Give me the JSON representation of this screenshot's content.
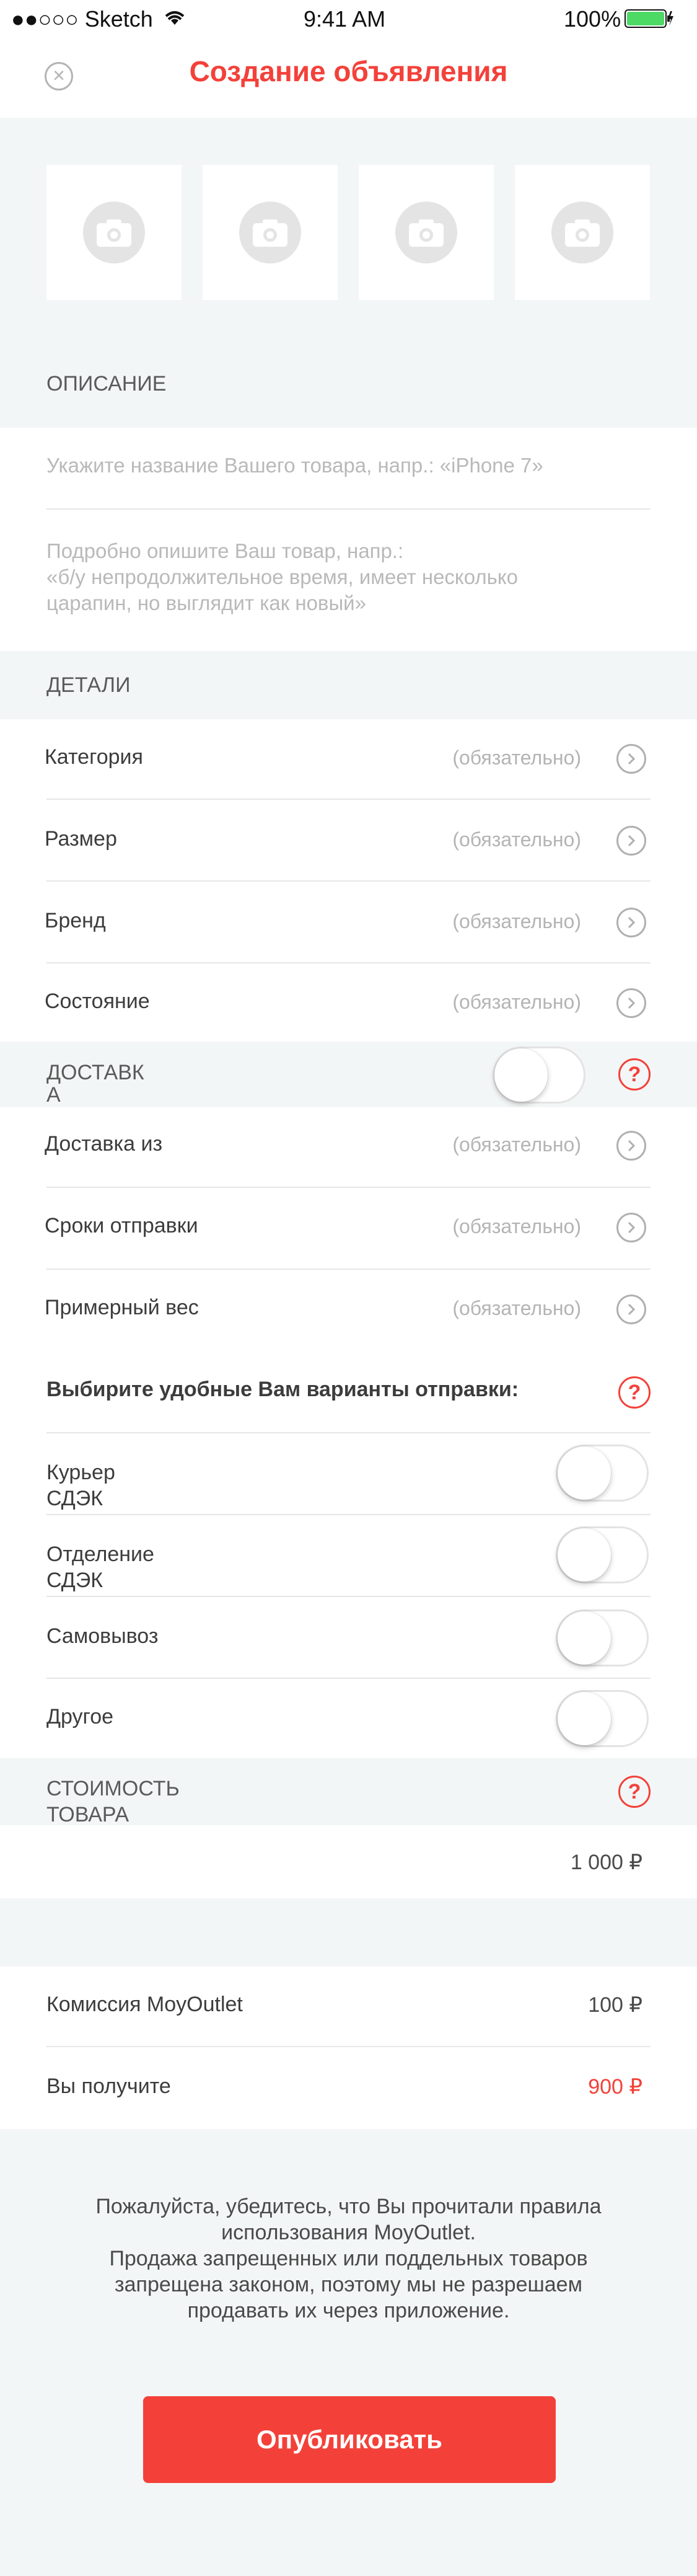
{
  "status_bar": {
    "carrier": "●●○○○ Sketch",
    "time": "9:41 AM",
    "battery": "100%"
  },
  "nav": {
    "title": "Создание объявления",
    "close_icon": "close-circle-icon"
  },
  "photos": {
    "count": 4,
    "icon": "camera-icon"
  },
  "description": {
    "header": "ОПИСАНИЕ",
    "title_placeholder": "Укажите название Вашего товара, напр.: «iPhone 7»",
    "body_placeholder_line1": "Подробно опишите Ваш товар, напр.:",
    "body_placeholder_line2": "«б/у непродолжительное время, имеет несколько",
    "body_placeholder_line3": "царапин, но выглядит как новый»"
  },
  "details": {
    "header": "ДЕТАЛИ",
    "rows": [
      {
        "label": "Категория",
        "value": "(обязательно)"
      },
      {
        "label": "Размер",
        "value": "(обязательно)"
      },
      {
        "label": "Бренд",
        "value": "(обязательно)"
      },
      {
        "label": "Состояние",
        "value": "(обязательно)"
      }
    ]
  },
  "delivery": {
    "header_line1": "ДОСТАВК",
    "header_line2": "А",
    "help": "?",
    "rows": [
      {
        "label": "Доставка из",
        "value": "(обязательно)"
      },
      {
        "label": "Сроки отправки",
        "value": "(обязательно)"
      },
      {
        "label": "Примерный вес",
        "value": "(обязательно)"
      }
    ],
    "options_title": "Выбирите удобные Вам варианты отправки:",
    "options_help": "?",
    "options": [
      {
        "line1": "Курьер",
        "line2": "СДЭК"
      },
      {
        "line1": "Отделение",
        "line2": "СДЭК"
      },
      {
        "line1": "Самовывоз",
        "line2": ""
      },
      {
        "line1": "Другое",
        "line2": ""
      }
    ]
  },
  "price": {
    "header_line1": "СТОИМОСТЬ",
    "header_line2": "ТОВАРА",
    "help": "?",
    "value": "1 000 ₽"
  },
  "summary": {
    "commission_label": "Комиссия MoyOutlet",
    "commission_value": "100 ₽",
    "receive_label": "Вы получите",
    "receive_value": "900 ₽"
  },
  "info": {
    "line1": "Пожалуйста, убедитесь, что Вы прочитали правила",
    "line2": "использования MoyOutlet.",
    "line3": "Продажа запрещенных или поддельных товаров",
    "line4": "запрещена законом, поэтому мы не разрешаем",
    "line5": "продавать их через приложение."
  },
  "publish_label": "Опубликовать",
  "colors": {
    "accent": "#f3413a",
    "background": "#f3f6f6",
    "placeholder": "#b9b9b9"
  }
}
